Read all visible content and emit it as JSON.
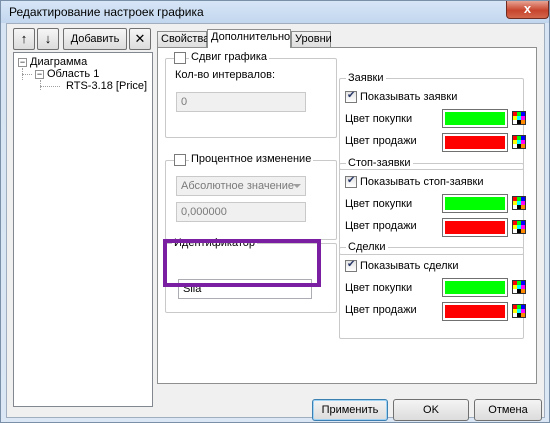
{
  "window": {
    "title": "Редактирование настроек графика",
    "close_glyph": "x"
  },
  "toolbar": {
    "up_glyph": "↑",
    "down_glyph": "↓",
    "add_label": "Добавить",
    "delete_glyph": "✕"
  },
  "tree": {
    "root": "Диаграмма",
    "area": "Область 1",
    "instrument": "RTS-3.18 [Price]"
  },
  "tabs": [
    "Свойства",
    "Дополнительно",
    "Уровни"
  ],
  "shift": {
    "checkbox_label": "Сдвиг графика",
    "checked": false,
    "intervals_label": "Кол-во интервалов:",
    "intervals_value": "0"
  },
  "percent": {
    "checkbox_label": "Процентное изменение",
    "checked": false,
    "mode_value": "Абсолютное значение",
    "number_value": "0,000000"
  },
  "identifier": {
    "legend": "Идентификатор",
    "value": "Sila"
  },
  "orders": {
    "legend": "Заявки",
    "checkbox_label": "Показывать заявки",
    "checked": true,
    "buy_label": "Цвет покупки",
    "sell_label": "Цвет продажи"
  },
  "stop_orders": {
    "legend": "Стоп-заявки",
    "checkbox_label": "Показывать стоп-заявки",
    "checked": true,
    "buy_label": "Цвет покупки",
    "sell_label": "Цвет продажи"
  },
  "deals": {
    "legend": "Сделки",
    "checkbox_label": "Показывать сделки",
    "checked": true,
    "buy_label": "Цвет покупки",
    "sell_label": "Цвет продажи"
  },
  "colors": {
    "buy": "#00ff00",
    "sell": "#ff0000",
    "highlight": "#7b1fa2"
  },
  "buttons": {
    "apply": "Применить",
    "ok": "OK",
    "cancel": "Отмена"
  }
}
